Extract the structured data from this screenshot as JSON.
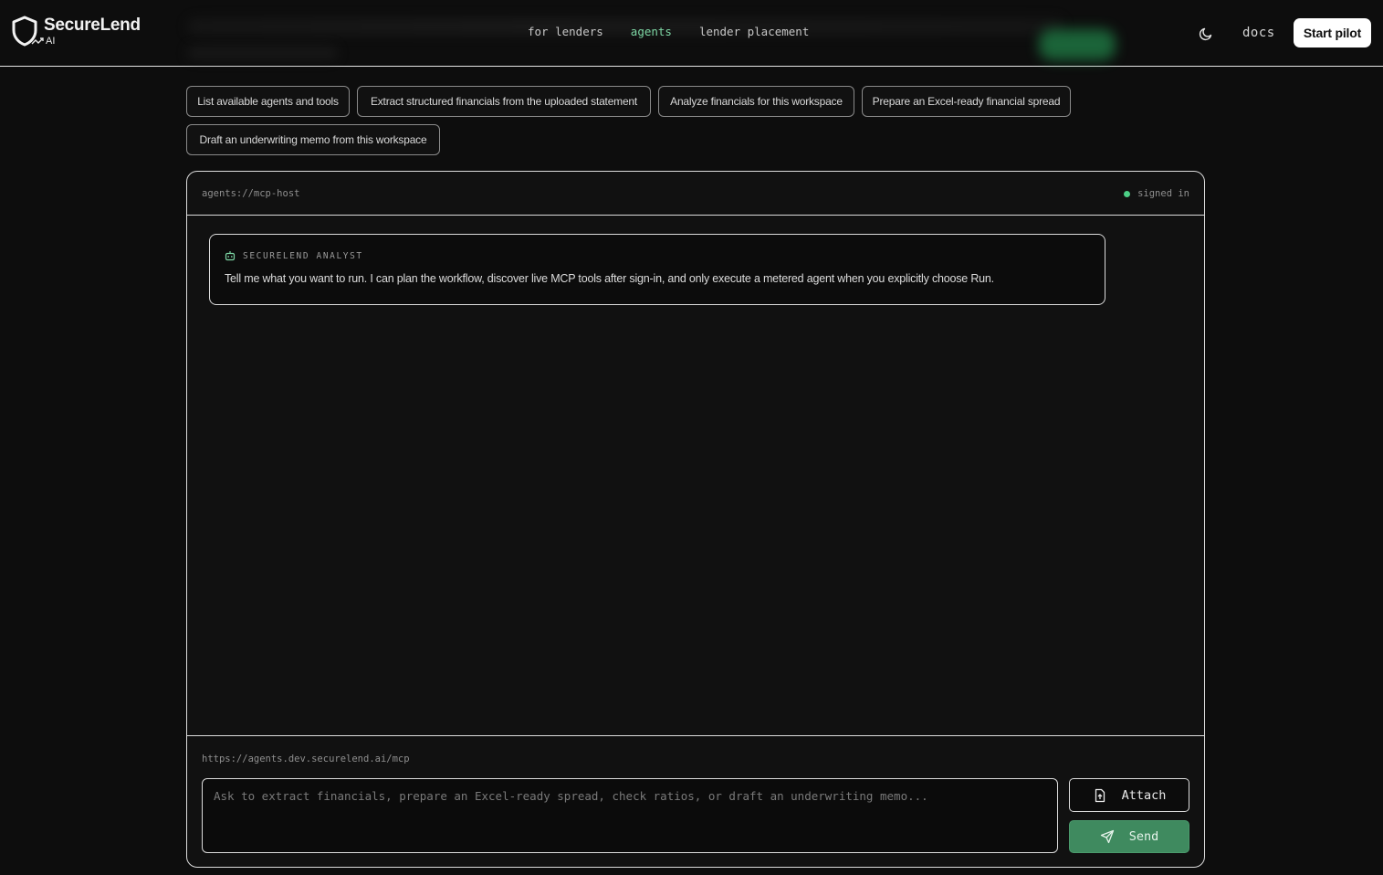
{
  "brand": {
    "name": "SecureLend",
    "sub": "AI"
  },
  "nav": {
    "items": [
      {
        "label": "for lenders",
        "active": false
      },
      {
        "label": "agents",
        "active": true
      },
      {
        "label": "lender placement",
        "active": false
      }
    ],
    "docs_label": "docs",
    "start_label": "Start pilot"
  },
  "suggestions": [
    "List available agents and tools",
    "Extract structured financials from the uploaded statement",
    "Analyze financials for this workspace",
    "Prepare an Excel-ready financial spread",
    "Draft an underwriting memo from this workspace"
  ],
  "panel": {
    "path": "agents://mcp-host",
    "status": "signed in",
    "message": {
      "author": "SECURELEND ANALYST",
      "text": "Tell me what you want to run. I can plan the workflow, discover live MCP tools after sign-in, and only execute a metered agent when you explicitly choose Run."
    },
    "endpoint": "https://agents.dev.securelend.ai/mcp",
    "input_placeholder": "Ask to extract financials, prepare an Excel-ready spread, check ratios, or draft an underwriting memo...",
    "input_value": "",
    "attach_label": "Attach",
    "send_label": "Send"
  },
  "colors": {
    "accent": "#7dd6a4",
    "send": "#3f8a5f",
    "status": "#4ccf86"
  },
  "icons": [
    "shield-icon",
    "trend-icon",
    "moon-icon",
    "bot-icon",
    "file-upload-icon",
    "send-icon"
  ]
}
